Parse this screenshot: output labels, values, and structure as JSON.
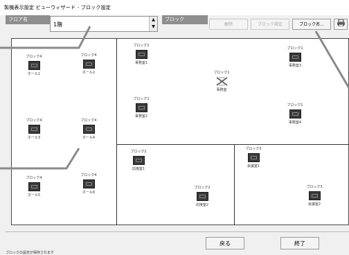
{
  "window": {
    "title": "製機表示設定 ビューウィザード - ブロック設定"
  },
  "toolbar": {
    "floor_label": "フロア名",
    "floor_value": "1階",
    "block_label": "ブロック",
    "btn_delete": "解除",
    "btn_block_settings": "ブロック設定",
    "btn_block_name": "ブロック名..."
  },
  "blocks": [
    {
      "units": [
        {
          "block": "ブロック4",
          "name": "ホール1"
        },
        {
          "block": "ブロック4",
          "name": "ホール2"
        },
        {
          "block": "ブロック4",
          "name": "ホール3"
        },
        {
          "block": "ブロック4",
          "name": "ホール4"
        },
        {
          "block": "ブロック4",
          "name": "ホール5"
        },
        {
          "block": "ブロック4",
          "name": "ホール6"
        }
      ]
    },
    {
      "units": [
        {
          "block": "ブロック1",
          "name": "事務室1"
        },
        {
          "block": "ブロック1",
          "name": "事務室3"
        },
        {
          "block": "ブロック1",
          "name": "事務室"
        },
        {
          "block": "ブロック1",
          "name": "事務室2"
        },
        {
          "block": "ブロック1",
          "name": "事務室4"
        }
      ]
    },
    {
      "units": [
        {
          "block": "ブロック2",
          "name": "応接室1"
        },
        {
          "block": "ブロック2",
          "name": "応接室2"
        }
      ]
    },
    {
      "units": [
        {
          "block": "ブロック3",
          "name": "会議室1"
        },
        {
          "block": "ブロック3",
          "name": "会議室2"
        }
      ]
    }
  ],
  "footer": {
    "back": "戻る",
    "finish": "終了",
    "status": "ブロックの設定が保存されます"
  }
}
